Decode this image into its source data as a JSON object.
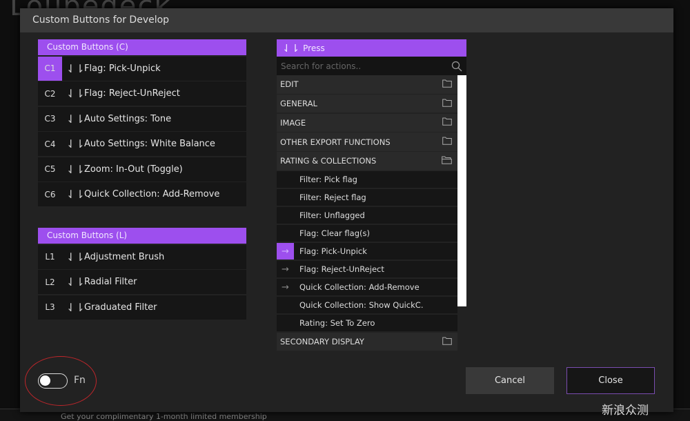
{
  "background": {
    "logo": "Loupedeck",
    "banner": "Get your complimentary 1-month limited membership",
    "watermark": "新浪众测"
  },
  "dialog": {
    "title": "Custom Buttons for Develop"
  },
  "custom_c": {
    "header": "Custom Buttons (C)",
    "rows": [
      {
        "key": "C1",
        "label": "Flag: Pick-Unpick",
        "selected": true
      },
      {
        "key": "C2",
        "label": "Flag: Reject-UnReject"
      },
      {
        "key": "C3",
        "label": "Auto Settings: Tone"
      },
      {
        "key": "C4",
        "label": "Auto Settings: White Balance"
      },
      {
        "key": "C5",
        "label": "Zoom: In-Out (Toggle)"
      },
      {
        "key": "C6",
        "label": "Quick Collection: Add-Remove"
      }
    ]
  },
  "custom_l": {
    "header": "Custom Buttons (L)",
    "rows": [
      {
        "key": "L1",
        "label": "Adjustment Brush"
      },
      {
        "key": "L2",
        "label": "Radial Filter"
      },
      {
        "key": "L3",
        "label": "Graduated Filter"
      }
    ]
  },
  "actions": {
    "header": "Press",
    "search_placeholder": "Search for actions..",
    "categories_top": [
      "EDIT",
      "GENERAL",
      "IMAGE",
      "OTHER EXPORT FUNCTIONS"
    ],
    "open_category": "RATING & COLLECTIONS",
    "items": [
      {
        "label": "Filter: Pick flag",
        "arrow": false
      },
      {
        "label": "Filter: Reject flag",
        "arrow": false
      },
      {
        "label": "Filter: Unflagged",
        "arrow": false
      },
      {
        "label": "Flag: Clear flag(s)",
        "arrow": false
      },
      {
        "label": "Flag: Pick-Unpick",
        "arrow": true,
        "selected": true
      },
      {
        "label": "Flag: Reject-UnReject",
        "arrow": true
      },
      {
        "label": "Quick Collection: Add-Remove",
        "arrow": true
      },
      {
        "label": "Quick Collection: Show QuickC.",
        "arrow": false
      },
      {
        "label": "Rating: Set To Zero",
        "arrow": false
      }
    ],
    "categories_bottom": [
      "SECONDARY DISPLAY"
    ]
  },
  "footer": {
    "fn_label": "Fn",
    "fn_on": false,
    "cancel": "Cancel",
    "close": "Close"
  },
  "colors": {
    "accent": "#9d4fee",
    "annotation": "#c0262b"
  }
}
